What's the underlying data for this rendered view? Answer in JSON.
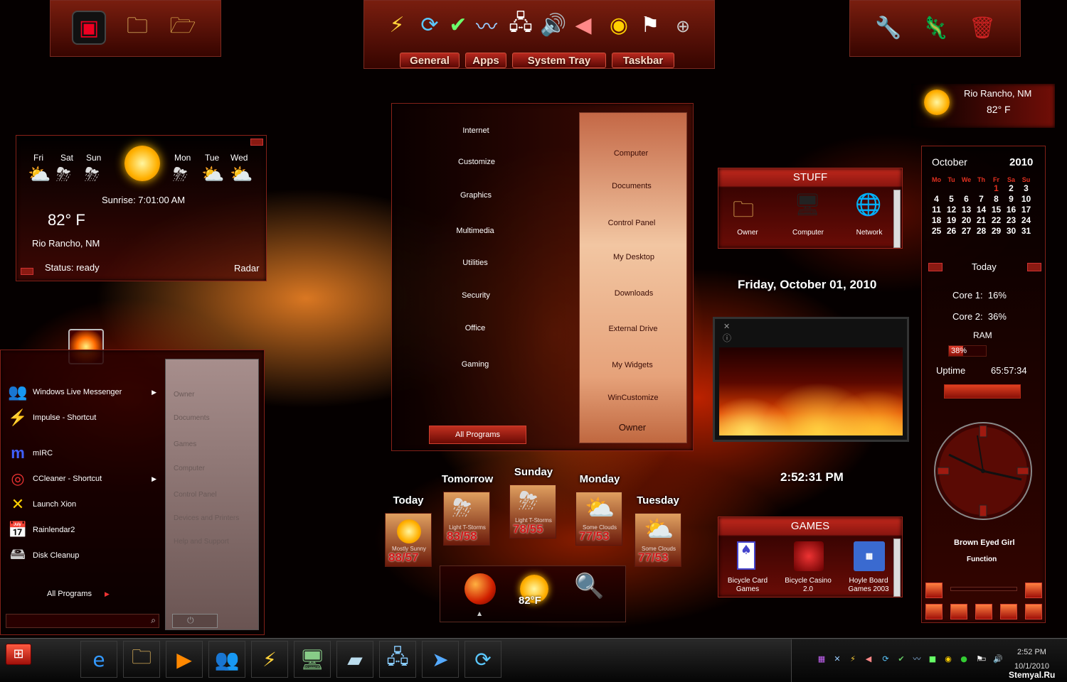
{
  "dock_left": {
    "items": [
      "zippo-monitor-icon",
      "notepad-folder-icon",
      "picture-folder-icon"
    ]
  },
  "dock_center": {
    "items": [
      "impulse-icon",
      "network-icon",
      "usb-safe-icon",
      "signal-icon",
      "network-computer-icon",
      "volume-icon",
      "speaker-icon",
      "security-check-icon",
      "flag-icon",
      "add-icon"
    ],
    "tabs": [
      "General",
      "Apps",
      "System Tray",
      "Taskbar"
    ]
  },
  "dock_right": {
    "items": [
      "tools-icon",
      "gecko-icon",
      "trash-icon"
    ]
  },
  "weather_mini": {
    "city": "Rio Rancho, NM",
    "temp": "82° F"
  },
  "weather_widget": {
    "days_left": [
      "Fri",
      "Sat",
      "Sun"
    ],
    "days_right": [
      "Mon",
      "Tue",
      "Wed"
    ],
    "sunrise": "Sunrise: 7:01:00 AM",
    "temp": "82° F",
    "city": "Rio Rancho, NM",
    "status": "Status: ready",
    "radar": "Radar"
  },
  "start_menu": {
    "items": [
      "Windows Live Messenger",
      "Impulse - Shortcut",
      "mIRC",
      "CCleaner - Shortcut",
      "Launch Xion",
      "Rainlendar2",
      "Disk Cleanup"
    ],
    "all_programs": "All Programs",
    "right_items": [
      "Owner",
      "Documents",
      "Games",
      "Computer",
      "Control Panel",
      "Devices and Printers",
      "Help and Support"
    ]
  },
  "center_menu": {
    "left": [
      "Internet",
      "Customize",
      "Graphics",
      "Multimedia",
      "Utilities",
      "Security",
      "Office",
      "Gaming"
    ],
    "all_programs": "All Programs",
    "right": [
      "Computer",
      "Documents",
      "Control Panel",
      "My Desktop",
      "Downloads",
      "External Drive",
      "My Widgets",
      "WinCustomize"
    ],
    "user": "Owner"
  },
  "stuff": {
    "title": "STUFF",
    "items": [
      "Owner",
      "Computer",
      "Network"
    ]
  },
  "date": "Friday, October 01, 2010",
  "time": "2:52:31 PM",
  "games": {
    "title": "GAMES",
    "items": [
      [
        "Bicycle Card",
        "Games"
      ],
      [
        "Bicycle Casino",
        "2.0"
      ],
      [
        "Hoyle Board",
        "Games 2003"
      ]
    ]
  },
  "forecast": [
    {
      "day": "Today",
      "desc": "Mostly Sunny",
      "temp": "88/57"
    },
    {
      "day": "Tomorrow",
      "desc": "Light T-Storms",
      "temp": "83/58"
    },
    {
      "day": "Sunday",
      "desc": "Light T-Storms",
      "temp": "78/55"
    },
    {
      "day": "Monday",
      "desc": "Some Clouds",
      "temp": "77/53"
    },
    {
      "day": "Tuesday",
      "desc": "Some Clouds",
      "temp": "77/53"
    }
  ],
  "mini_dock": {
    "temp": "82°F"
  },
  "calendar": {
    "month": "October",
    "year": "2010",
    "headers": [
      "Mo",
      "Tu",
      "We",
      "Th",
      "Fr",
      "Sa",
      "Su"
    ],
    "rows": [
      [
        "",
        "",
        "",
        "",
        "1",
        "2",
        "3"
      ],
      [
        "4",
        "5",
        "6",
        "7",
        "8",
        "9",
        "10"
      ],
      [
        "11",
        "12",
        "13",
        "14",
        "15",
        "16",
        "17"
      ],
      [
        "18",
        "19",
        "20",
        "21",
        "22",
        "23",
        "24"
      ],
      [
        "25",
        "26",
        "27",
        "28",
        "29",
        "30",
        "31"
      ]
    ],
    "today": "Today"
  },
  "sysmon": {
    "core1": "Core 1:  16%",
    "core2": "Core 2:  36%",
    "ram_label": "RAM",
    "ram_value": "38%",
    "ram_fraction": 0.38,
    "uptime_label": "Uptime",
    "uptime": "65:57:34"
  },
  "media": {
    "track": "Brown Eyed Girl",
    "function": "Function"
  },
  "taskbar": {
    "pinned": [
      "ie-icon",
      "explorer-icon",
      "media-player-icon",
      "messenger-icon",
      "impulse-icon",
      "monitor-icon",
      "notepad-icon",
      "remote-icon",
      "cursor-icon",
      "network-icon"
    ],
    "clock_time": "2:52 PM",
    "clock_date": "10/1/2010",
    "watermark": "Stemyal.Ru"
  },
  "colors": {
    "accent": "#c0281c",
    "dark": "#1a0000"
  }
}
